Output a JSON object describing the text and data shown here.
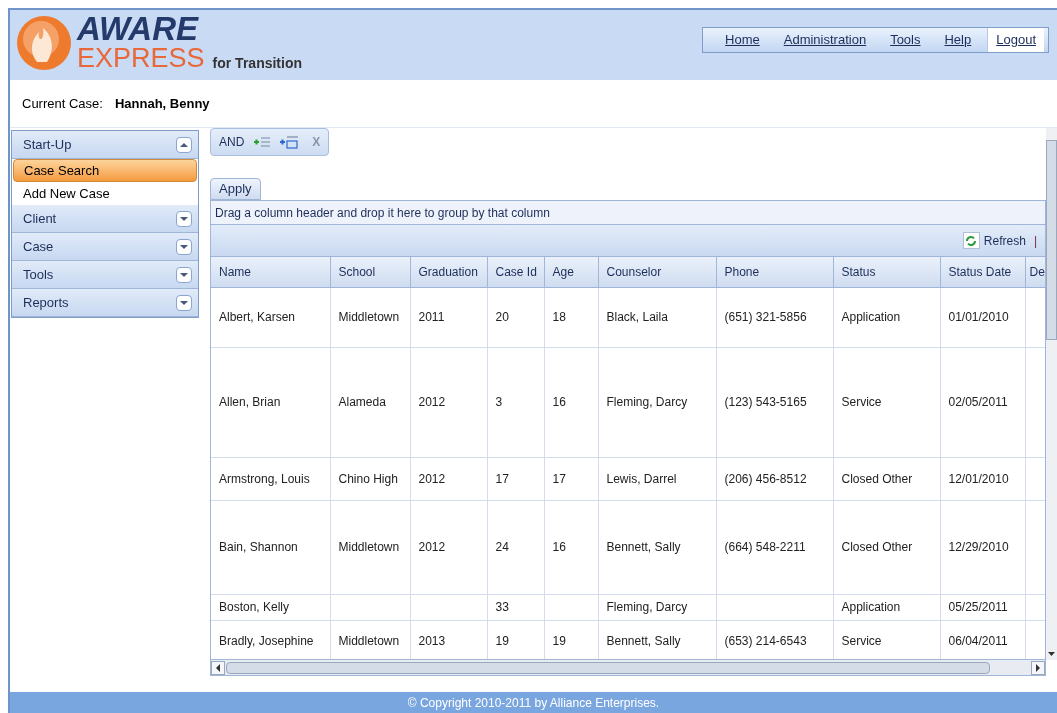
{
  "header": {
    "logo_line1": "AWARE",
    "logo_line2": "EXPRESS",
    "subtitle": "for Transition"
  },
  "menu": [
    {
      "label": "Home",
      "selected": false
    },
    {
      "label": "Administration",
      "selected": false
    },
    {
      "label": "Tools",
      "selected": false
    },
    {
      "label": "Help",
      "selected": false
    },
    {
      "label": "Logout",
      "selected": true
    }
  ],
  "current_case": {
    "label": "Current Case:",
    "value": "Hannah, Benny"
  },
  "sidebar": [
    {
      "title": "Start-Up",
      "expanded": true,
      "items": [
        {
          "label": "Case Search",
          "selected": true
        },
        {
          "label": "Add New Case",
          "selected": false
        }
      ]
    },
    {
      "title": "Client",
      "expanded": false
    },
    {
      "title": "Case",
      "expanded": false
    },
    {
      "title": "Tools",
      "expanded": false
    },
    {
      "title": "Reports",
      "expanded": false
    }
  ],
  "filter": {
    "operator": "AND",
    "close": "X",
    "apply": "Apply"
  },
  "group_hint": "Drag a column header and drop it here to group by that column",
  "refresh": "Refresh",
  "toolbar_separator": "|",
  "table": {
    "columns": [
      "Name",
      "School",
      "Graduation",
      "Case Id",
      "Age",
      "Counselor",
      "Phone",
      "Status",
      "Status Date",
      "De"
    ],
    "rows": [
      [
        "Albert, Karsen",
        "Middletown",
        "2011",
        "20",
        "18",
        "Black, Laila",
        "(651) 321-5856",
        "Application",
        "01/01/2010",
        ""
      ],
      [
        "Allen, Brian",
        "Alameda",
        "2012",
        "3",
        "16",
        "Fleming, Darcy",
        "(123) 543-5165",
        "Service",
        "02/05/2011",
        ""
      ],
      [
        "Armstrong, Louis",
        "Chino High",
        "2012",
        "17",
        "17",
        "Lewis, Darrel",
        "(206) 456-8512",
        "Closed Other",
        "12/01/2010",
        ""
      ],
      [
        "Bain, Shannon",
        "Middletown",
        "2012",
        "24",
        "16",
        "Bennett, Sally",
        "(664) 548-2211",
        "Closed Other",
        "12/29/2010",
        ""
      ],
      [
        "Boston, Kelly",
        "",
        "",
        "33",
        "",
        "Fleming, Darcy",
        "",
        "Application",
        "05/25/2011",
        ""
      ],
      [
        "Bradly, Josephine",
        "Middletown",
        "2013",
        "19",
        "19",
        "Bennett, Sally",
        "(653) 214-6543",
        "Service",
        "06/04/2011",
        ""
      ]
    ]
  },
  "footer": "© Copyright 2010-2011 by Alliance Enterprises."
}
